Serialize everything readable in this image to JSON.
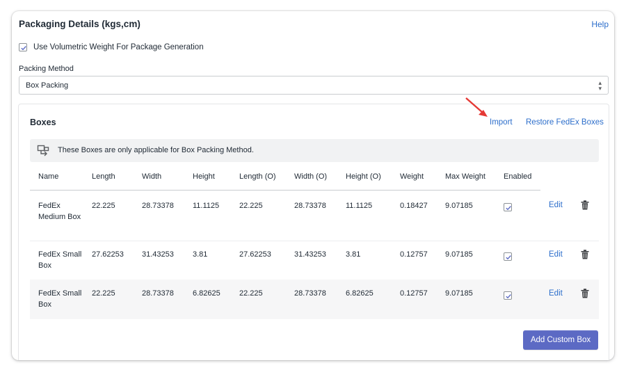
{
  "header": {
    "title": "Packaging Details (kgs,cm)",
    "help_label": "Help"
  },
  "volumetric": {
    "checked": true,
    "label": "Use Volumetric Weight For Package Generation"
  },
  "packing_method": {
    "label": "Packing Method",
    "selected": "Box Packing"
  },
  "boxes": {
    "title": "Boxes",
    "import_label": "Import",
    "restore_label": "Restore FedEx Boxes",
    "info_text": "These Boxes are only applicable for Box Packing Method.",
    "columns": [
      "Name",
      "Length",
      "Width",
      "Height",
      "Length (O)",
      "Width (O)",
      "Height (O)",
      "Weight",
      "Max Weight",
      "Enabled"
    ],
    "rows": [
      {
        "name": "FedEx Medium Box",
        "length": "22.225",
        "width": "28.73378",
        "height": "11.1125",
        "length_o": "22.225",
        "width_o": "28.73378",
        "height_o": "11.1125",
        "weight": "0.18427",
        "max_weight": "9.07185",
        "enabled": true,
        "edit_label": "Edit"
      },
      {
        "name": "FedEx Small Box",
        "length": "27.62253",
        "width": "31.43253",
        "height": "3.81",
        "length_o": "27.62253",
        "width_o": "31.43253",
        "height_o": "3.81",
        "weight": "0.12757",
        "max_weight": "9.07185",
        "enabled": true,
        "edit_label": "Edit"
      },
      {
        "name": "FedEx Small Box",
        "length": "22.225",
        "width": "28.73378",
        "height": "6.82625",
        "length_o": "22.225",
        "width_o": "28.73378",
        "height_o": "6.82625",
        "weight": "0.12757",
        "max_weight": "9.07185",
        "enabled": true,
        "edit_label": "Edit"
      }
    ],
    "add_button_label": "Add Custom Box"
  },
  "colors": {
    "accent": "#5c6ac4",
    "link": "#2c6ecb",
    "annotation_arrow": "#e53935"
  },
  "icons": [
    "checkmark-icon",
    "select-arrows-icon",
    "box-flow-icon",
    "trash-icon",
    "red-arrow-icon"
  ]
}
